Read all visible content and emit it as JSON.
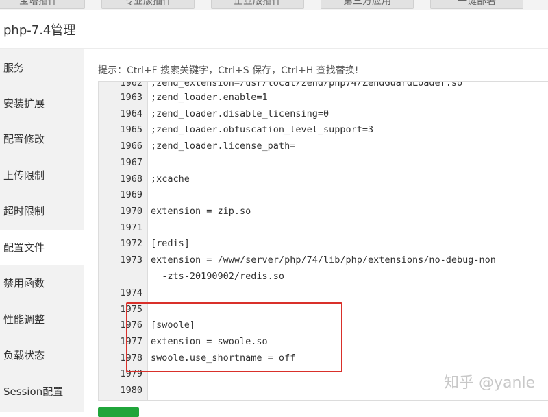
{
  "top_tabs": [
    "宝塔插件",
    "专业版插件",
    "企业版插件",
    "第三方应用",
    "一键部署"
  ],
  "window_title": "php-7.4管理",
  "sidebar": {
    "items": [
      {
        "label": "服务",
        "active": false
      },
      {
        "label": "安装扩展",
        "active": false
      },
      {
        "label": "配置修改",
        "active": false
      },
      {
        "label": "上传限制",
        "active": false
      },
      {
        "label": "超时限制",
        "active": false
      },
      {
        "label": "配置文件",
        "active": true
      },
      {
        "label": "禁用函数",
        "active": false
      },
      {
        "label": "性能调整",
        "active": false
      },
      {
        "label": "负载状态",
        "active": false
      },
      {
        "label": "Session配置",
        "active": false
      }
    ]
  },
  "hint": "提示：Ctrl+F 搜索关键字，Ctrl+S 保存，Ctrl+H 查找替换!",
  "editor": {
    "lines": [
      {
        "num": "1962",
        "text": ";zend_extension=/usr/local/zend/php74/ZendGuardLoader.so"
      },
      {
        "num": "1963",
        "text": ";zend_loader.enable=1"
      },
      {
        "num": "1964",
        "text": ";zend_loader.disable_licensing=0"
      },
      {
        "num": "1965",
        "text": ";zend_loader.obfuscation_level_support=3"
      },
      {
        "num": "1966",
        "text": ";zend_loader.license_path="
      },
      {
        "num": "1967",
        "text": ""
      },
      {
        "num": "1968",
        "text": ";xcache"
      },
      {
        "num": "1969",
        "text": ""
      },
      {
        "num": "1970",
        "text": "extension = zip.so"
      },
      {
        "num": "1971",
        "text": ""
      },
      {
        "num": "1972",
        "text": "[redis]"
      },
      {
        "num": "1973",
        "text": "extension = /www/server/php/74/lib/php/extensions/no-debug-non"
      },
      {
        "num": "",
        "text": "  -zts-20190902/redis.so"
      },
      {
        "num": "1974",
        "text": ""
      },
      {
        "num": "1975",
        "text": ""
      },
      {
        "num": "1976",
        "text": "[swoole]"
      },
      {
        "num": "1977",
        "text": "extension = swoole.so"
      },
      {
        "num": "1978",
        "text": "swoole.use_shortname = off"
      },
      {
        "num": "1979",
        "text": ""
      },
      {
        "num": "1980",
        "text": ""
      }
    ]
  },
  "watermark": "知乎 @yanle",
  "colors": {
    "highlight_border": "#d9302a",
    "save_button": "#20a53a"
  }
}
